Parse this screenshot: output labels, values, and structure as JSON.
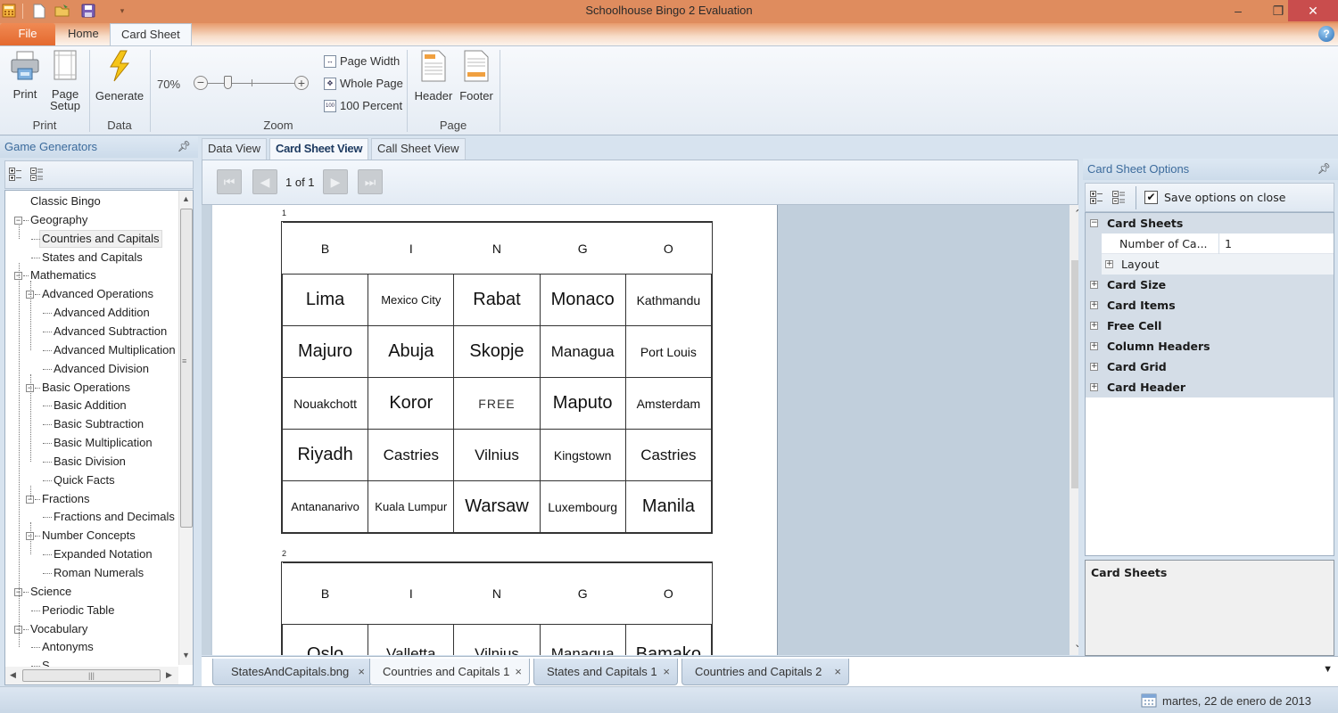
{
  "window": {
    "title": "Schoolhouse Bingo 2 Evaluation",
    "controls": {
      "minimize": "–",
      "restore": "❐",
      "close": "✕"
    }
  },
  "quick_access": [
    "app-icon",
    "new-icon",
    "open-icon",
    "save-icon",
    "customize-icon"
  ],
  "ribbon": {
    "tabs": {
      "file": "File",
      "home": "Home",
      "card_sheet": "Card Sheet"
    },
    "groups": {
      "print": {
        "label": "Print",
        "print": "Print",
        "page_setup_1": "Page",
        "page_setup_2": "Setup"
      },
      "data": {
        "label": "Data",
        "generate": "Generate"
      },
      "zoom": {
        "label": "Zoom",
        "level": "70%",
        "level_value": 70,
        "page_width": "Page Width",
        "whole_page": "Whole Page",
        "percent_100": "100 Percent",
        "icon_100": "100"
      },
      "page": {
        "label": "Page",
        "header": "Header",
        "footer": "Footer"
      }
    },
    "help": "?"
  },
  "left_panel": {
    "title": "Game Generators",
    "tree": [
      {
        "label": "Classic Bingo",
        "level": 0,
        "expander": null
      },
      {
        "label": "Geography",
        "level": 0,
        "expander": "−"
      },
      {
        "label": "Countries and Capitals",
        "level": 1,
        "selected": true
      },
      {
        "label": "States and Capitals",
        "level": 1
      },
      {
        "label": "Mathematics",
        "level": 0,
        "expander": "−"
      },
      {
        "label": "Advanced Operations",
        "level": 1,
        "expander": "−"
      },
      {
        "label": "Advanced Addition",
        "level": 2
      },
      {
        "label": "Advanced Subtraction",
        "level": 2
      },
      {
        "label": "Advanced Multiplication",
        "level": 2
      },
      {
        "label": "Advanced Division",
        "level": 2
      },
      {
        "label": "Basic Operations",
        "level": 1,
        "expander": "−"
      },
      {
        "label": "Basic Addition",
        "level": 2
      },
      {
        "label": "Basic Subtraction",
        "level": 2
      },
      {
        "label": "Basic Multiplication",
        "level": 2
      },
      {
        "label": "Basic Division",
        "level": 2
      },
      {
        "label": "Quick Facts",
        "level": 2
      },
      {
        "label": "Fractions",
        "level": 1,
        "expander": "−"
      },
      {
        "label": "Fractions and Decimals",
        "level": 2
      },
      {
        "label": "Number Concepts",
        "level": 1,
        "expander": "−"
      },
      {
        "label": "Expanded Notation",
        "level": 2
      },
      {
        "label": "Roman Numerals",
        "level": 2
      },
      {
        "label": "Science",
        "level": 0,
        "expander": "−"
      },
      {
        "label": "Periodic Table",
        "level": 1
      },
      {
        "label": "Vocabulary",
        "level": 0,
        "expander": "−"
      },
      {
        "label": "Antonyms",
        "level": 1
      },
      {
        "label": "S…",
        "level": 1
      }
    ]
  },
  "view_tabs": {
    "data_view": "Data View",
    "card_sheet_view": "Card Sheet View",
    "call_sheet_view": "Call Sheet View"
  },
  "viewer": {
    "page_indicator": "1 of 1",
    "cards": [
      {
        "number": "1",
        "header": [
          "B",
          "I",
          "N",
          "G",
          "O"
        ],
        "rows": [
          [
            "Lima",
            "Mexico City",
            "Rabat",
            "Monaco",
            "Kathmandu"
          ],
          [
            "Majuro",
            "Abuja",
            "Skopje",
            "Managua",
            "Port Louis"
          ],
          [
            "Nouakchott",
            "Koror",
            "FREE",
            "Maputo",
            "Amsterdam"
          ],
          [
            "Riyadh",
            "Castries",
            "Vilnius",
            "Kingstown",
            "Castries"
          ],
          [
            "Antananarivo",
            "Kuala Lumpur",
            "Warsaw",
            "Luxembourg",
            "Manila"
          ]
        ]
      },
      {
        "number": "2",
        "header": [
          "B",
          "I",
          "N",
          "G",
          "O"
        ],
        "rows": [
          [
            "Oslo",
            "Valletta",
            "Vilnius",
            "Managua",
            "Bamako"
          ]
        ]
      }
    ]
  },
  "document_tabs": [
    {
      "label": "StatesAndCapitals.bng",
      "active": false
    },
    {
      "label": "Countries and Capitals 1",
      "active": true
    },
    {
      "label": "States and Capitals 1",
      "active": false
    },
    {
      "label": "Countries and Capitals 2",
      "active": false
    }
  ],
  "right_panel": {
    "title": "Card Sheet Options",
    "save_on_close_label": "Save options on close",
    "save_on_close_checked": true,
    "categories": [
      {
        "label": "Card Sheets",
        "expanded": true,
        "properties": [
          {
            "name": "Number of Ca...",
            "value": "1"
          }
        ],
        "subcategories": [
          {
            "label": "Layout",
            "expanded": false
          }
        ]
      },
      {
        "label": "Card Size",
        "expanded": false
      },
      {
        "label": "Card Items",
        "expanded": false
      },
      {
        "label": "Free Cell",
        "expanded": false
      },
      {
        "label": "Column Headers",
        "expanded": false
      },
      {
        "label": "Card Grid",
        "expanded": false
      },
      {
        "label": "Card Header",
        "expanded": false
      }
    ],
    "description_title": "Card Sheets"
  },
  "status_bar": {
    "date": "martes, 22 de enero de 2013"
  }
}
